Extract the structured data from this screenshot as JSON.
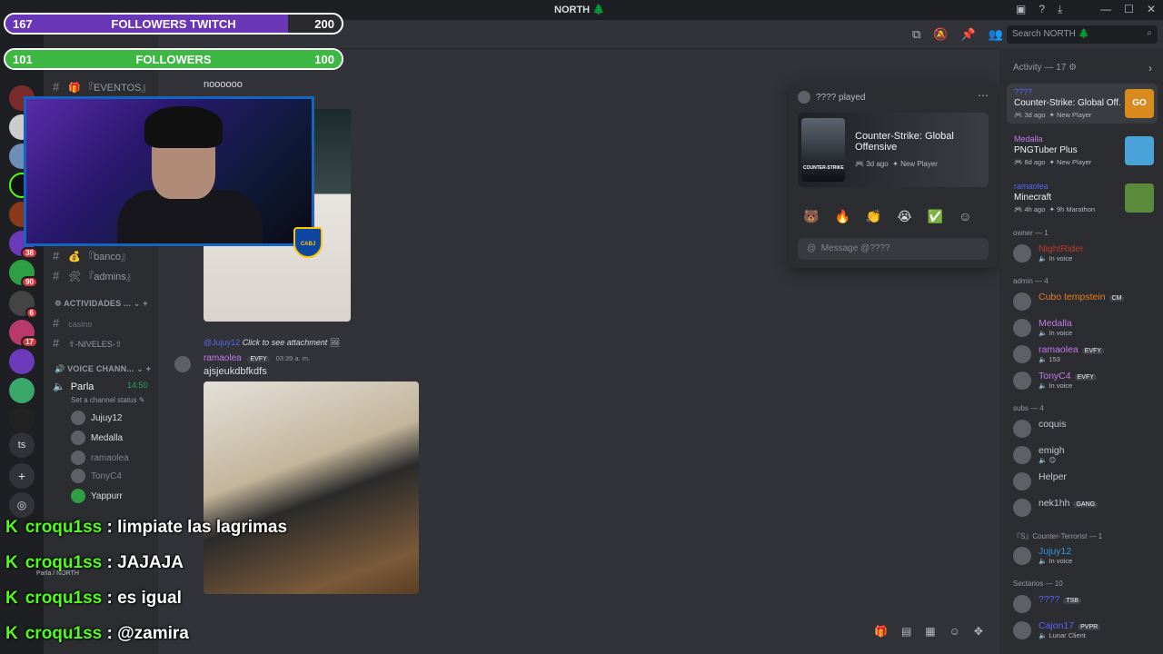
{
  "window": {
    "title": "NORTH",
    "leaf_icon": "🌲"
  },
  "overlay": {
    "twitch_bar": {
      "left": "167",
      "label": "FOLLOWERS TWITCH",
      "right": "200",
      "progress": 0.84
    },
    "followers_bar": {
      "left": "101",
      "label": "FOLLOWERS",
      "right": "100",
      "progress": 1.0
    },
    "crest_text": "CABJ",
    "twitch_chat": [
      {
        "user": "croqu1ss",
        "text": ": limpiate las lagrimas"
      },
      {
        "user": "croqu1ss",
        "text": ": JAJAJA"
      },
      {
        "user": "croqu1ss",
        "text": ": es igual"
      },
      {
        "user": "croqu1ss",
        "text": ": @zamira"
      }
    ]
  },
  "rail": {
    "badges": [
      "38",
      "90",
      "6",
      "17"
    ],
    "ts_label": "ts"
  },
  "sidebar": {
    "channels": [
      {
        "name": "『EVENTOS』"
      },
      {
        "name": "『banco』"
      },
      {
        "name": "『admins』"
      }
    ],
    "category_activities": "ACTIVIDADES ...",
    "activity_channels": [
      {
        "name": "casino"
      },
      {
        "name": "⇧-NIVELES-⇧"
      }
    ],
    "category_voice": "VOICE CHANN...",
    "voice_channel": {
      "name": "Parla",
      "time": "14:50",
      "status_prompt": "Set a channel status"
    },
    "voice_users": [
      "Jujuy12",
      "Medalla",
      "ramaolea",
      "TonyC4",
      "Yappurr"
    ],
    "voice_footer": "Parla / NORTH"
  },
  "header": {
    "search_placeholder": "Search NORTH"
  },
  "chat": {
    "msg_top": "noooooo",
    "reply_user": "@Jujuy12",
    "reply_text": "Click to see attachment",
    "author": "ramaolea",
    "author_tag": "EVFY",
    "time": "03:39 a. m.",
    "text": "ajsjeukdbfkdfs"
  },
  "popout": {
    "who": "???? played",
    "game": "Counter-Strike: Global Offensive",
    "art_label": "COUNTER-STRIKE",
    "ago": "3d ago",
    "new_player": "New Player",
    "reactions": [
      "🐻",
      "🔥",
      "👏",
      "😭",
      "✅",
      "☺"
    ],
    "message_placeholder": "Message @????"
  },
  "members": {
    "activity_header": "Activity — 17",
    "activities": [
      {
        "who": "????",
        "game": "Counter-Strike: Global Off...",
        "ago": "3d ago",
        "note": "New Player",
        "who_color": "#5865f2",
        "thumb_label": "GO",
        "thumb_color": "#d98a1c"
      },
      {
        "who": "Medalla",
        "game": "PNGTuber Plus",
        "ago": "8d ago",
        "note": "New Player",
        "who_color": "#c27ae8",
        "thumb_label": "",
        "thumb_color": "#4aa3d8"
      },
      {
        "who": "ramaolea",
        "game": "Minecraft",
        "ago": "4h ago",
        "note": "9h Marathon",
        "who_color": "#5865f2",
        "thumb_label": "",
        "thumb_color": "#5b8b3a"
      }
    ],
    "groups": [
      {
        "name": "owner — 1",
        "items": [
          {
            "name": "NightRider",
            "status": "In voice",
            "color": "#c0392b",
            "tag": ""
          }
        ]
      },
      {
        "name": "admin — 4",
        "items": [
          {
            "name": "Cubo tempstein",
            "status": "",
            "color": "#e67e22",
            "tag": "CM"
          },
          {
            "name": "Medalla",
            "status": "In voice",
            "color": "#c27ae8",
            "tag": ""
          },
          {
            "name": "ramaolea",
            "status": "153",
            "color": "#c27ae8",
            "tag": "EVFY"
          },
          {
            "name": "TonyC4",
            "status": "In voice",
            "color": "#c27ae8",
            "tag": "EVFY"
          }
        ]
      },
      {
        "name": "subs — 4",
        "items": [
          {
            "name": "coquis",
            "status": "",
            "color": "#c4c9ce",
            "tag": ""
          },
          {
            "name": "emigh",
            "status": "😊",
            "color": "#c4c9ce",
            "tag": ""
          },
          {
            "name": "Helper",
            "status": "",
            "color": "#c4c9ce",
            "tag": ""
          },
          {
            "name": "nek1hh",
            "status": "",
            "color": "#c4c9ce",
            "tag": "GANG"
          }
        ]
      },
      {
        "name": "『S』Counter-Terrorist — 1",
        "items": [
          {
            "name": "Jujuy12",
            "status": "In voice",
            "color": "#3498db",
            "tag": ""
          }
        ]
      },
      {
        "name": "Sectarios — 10",
        "items": [
          {
            "name": "????",
            "status": "",
            "color": "#5865f2",
            "tag": "TSB"
          },
          {
            "name": "Cajon17",
            "status": "Lunar Client",
            "color": "#5865f2",
            "tag": "PVPR"
          }
        ]
      }
    ]
  }
}
